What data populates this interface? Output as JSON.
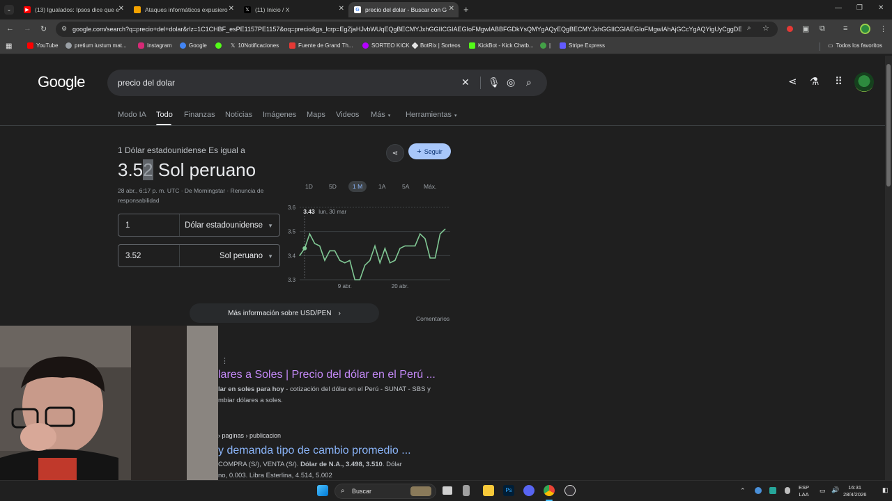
{
  "tabs": [
    {
      "title": "(13) Igualados: Ipsos dice que e",
      "icon": "youtube-icon",
      "color": "#ff0000"
    },
    {
      "title": "Ataques informáticos expusiero",
      "icon": "news-icon",
      "color": "#f4a300"
    },
    {
      "title": "(11) Inicio / X",
      "icon": "x-icon",
      "color": "#000000"
    },
    {
      "title": "precio del dolar - Buscar con G",
      "icon": "google-icon",
      "color": "#ffffff",
      "active": true
    }
  ],
  "address": "google.com/search?q=precio+del+dolar&rlz=1C1CHBF_esPE1157PE1157&oq=precio&gs_lcrp=EgZjaHJvbWUqEQgBECMYJxhGGIICGIAEGIoFMgwIABBFGDkYsQMYgAQyEQgBECMYJxhGGIICGIAEGIoFMgwIAhAjGCcYgAQYigUyCggDE...",
  "bookmarks": [
    {
      "label": "YouTube",
      "color": "#ff0000"
    },
    {
      "label": "pretium iustum mat...",
      "color": "#9aa0a6"
    },
    {
      "label": "Instagram",
      "color": "#d62976"
    },
    {
      "label": "Google",
      "color": "#4285f4"
    },
    {
      "label": "",
      "color": "#53fc18"
    },
    {
      "label": "10Notificaciones",
      "color": "#e3e3e3"
    },
    {
      "label": "Fuente de Grand Th...",
      "color": "#e53935"
    },
    {
      "label": "SORTEO KICK",
      "color": "#b400ff"
    },
    {
      "label": "BotRix | Sorteos",
      "color": "#e3e3e3"
    },
    {
      "label": "KickBot - Kick Chatb...",
      "color": "#53fc18"
    },
    {
      "label": "|",
      "color": "#43a047"
    },
    {
      "label": "Stripe Express",
      "color": "#635bff"
    }
  ],
  "all_bookmarks": "Todos los favoritos",
  "logo": "Google",
  "search_query": "precio del dolar",
  "nav_tabs": [
    "Modo IA",
    "Todo",
    "Finanzas",
    "Noticias",
    "Imágenes",
    "Maps",
    "Videos",
    "Más",
    "Herramientas"
  ],
  "converter": {
    "equals_label": "1 Dólar estadounidense Es igual a",
    "rate_prefix": "3.5",
    "rate_highlight": "2",
    "rate_suffix": " Sol peruano",
    "meta_date": "28 abr., 6:17 p. m. UTC",
    "meta_source": "De Morningstar",
    "meta_disclaimer": "Renuncia de responsabilidad",
    "from_value": "1",
    "from_currency": "Dólar estadounidense",
    "to_value": "3.52",
    "to_currency": "Sol peruano",
    "follow_label": "Seguir",
    "ranges": [
      "1D",
      "5D",
      "1 M",
      "1A",
      "5A",
      "Máx."
    ],
    "active_range": "1 M",
    "tooltip_value": "3.43",
    "tooltip_date": "lun, 30 mar",
    "more_info": "Más información sobre USD/PEN",
    "feedback": "Comentarios"
  },
  "chart_data": {
    "type": "line",
    "title": "",
    "xlabel": "",
    "ylabel": "",
    "ylim": [
      3.3,
      3.6
    ],
    "yticks": [
      3.6,
      3.5,
      3.4,
      3.3
    ],
    "xticks": [
      {
        "label": "9 abr.",
        "x": 9
      },
      {
        "label": "20 abr.",
        "x": 20
      }
    ],
    "xlim": [
      0,
      30
    ],
    "series": [
      {
        "values": [
          {
            "x": 0,
            "y": 3.4
          },
          {
            "x": 1,
            "y": 3.43
          },
          {
            "x": 2,
            "y": 3.49
          },
          {
            "x": 3,
            "y": 3.45
          },
          {
            "x": 4,
            "y": 3.44
          },
          {
            "x": 5,
            "y": 3.38
          },
          {
            "x": 6,
            "y": 3.42
          },
          {
            "x": 7,
            "y": 3.42
          },
          {
            "x": 8,
            "y": 3.38
          },
          {
            "x": 9,
            "y": 3.37
          },
          {
            "x": 10,
            "y": 3.38
          },
          {
            "x": 11,
            "y": 3.3
          },
          {
            "x": 12,
            "y": 3.3
          },
          {
            "x": 13,
            "y": 3.36
          },
          {
            "x": 14,
            "y": 3.38
          },
          {
            "x": 15,
            "y": 3.44
          },
          {
            "x": 16,
            "y": 3.37
          },
          {
            "x": 17,
            "y": 3.43
          },
          {
            "x": 18,
            "y": 3.37
          },
          {
            "x": 19,
            "y": 3.38
          },
          {
            "x": 20,
            "y": 3.43
          },
          {
            "x": 21,
            "y": 3.44
          },
          {
            "x": 22,
            "y": 3.44
          },
          {
            "x": 23,
            "y": 3.44
          },
          {
            "x": 24,
            "y": 3.49
          },
          {
            "x": 25,
            "y": 3.47
          },
          {
            "x": 26,
            "y": 3.39
          },
          {
            "x": 27,
            "y": 3.39
          },
          {
            "x": 28,
            "y": 3.49
          },
          {
            "x": 29,
            "y": 3.51
          }
        ]
      }
    ],
    "highlight": {
      "x": 1,
      "y": 3.43
    },
    "line_color": "#81c995"
  },
  "results": [
    {
      "title": "lares a Soles | Precio del dólar en el Perú ...",
      "snippet_bold": "lar en soles para hoy",
      "snippet": " - cotización del dólar en el Perú - SUNAT - SBS y",
      "snippet2": "mbiar dólares a soles.",
      "title_color": "#c58af9"
    },
    {
      "crumb": "› paginas › publicacion",
      "title": "y demanda tipo de cambio promedio ...",
      "snippet": "COMPRA (S/), VENTA (S/). ",
      "snippet_bold": "Dólar de N.A., 3.498, 3.510",
      "snippet_tail": ". Dólar",
      "snippet2": "no, 0.003. Libra Esterlina, 4.514, 5.002",
      "title_color": "#8ab4f8"
    }
  ],
  "taskbar": {
    "search_label": "Buscar",
    "lang": "ESP",
    "lang2": "LAA",
    "time": "16:31",
    "date": "28/4/2026"
  }
}
